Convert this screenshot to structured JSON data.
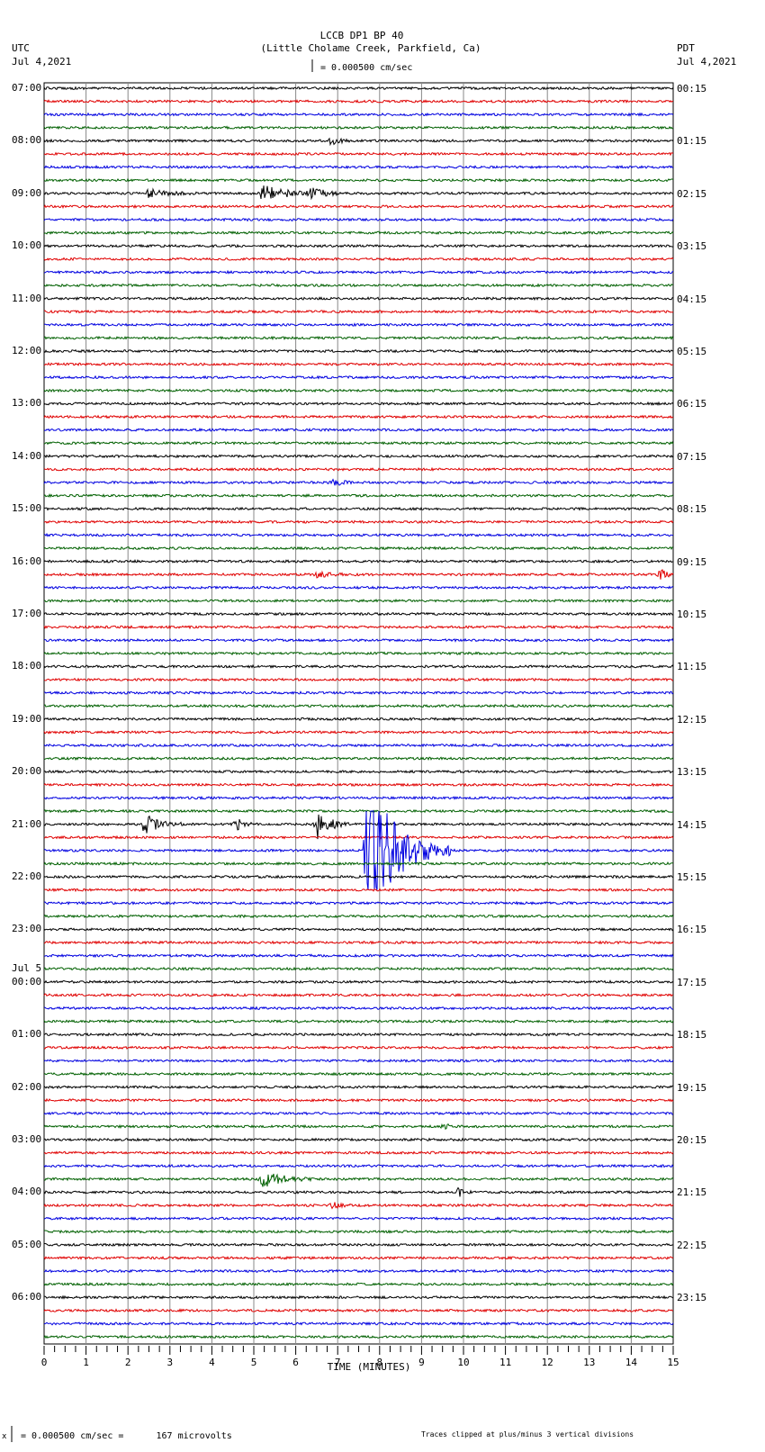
{
  "header": {
    "title": "LCCB DP1 BP 40",
    "subtitle": "(Little Cholame Creek, Parkfield, Ca)",
    "left_tz": "UTC",
    "left_date": "Jul 4,2021",
    "right_tz": "PDT",
    "right_date": "Jul 4,2021",
    "scale_label": "= 0.000500 cm/sec"
  },
  "footer": {
    "scale_note": "= 0.000500 cm/sec =      167 microvolts",
    "clip_note": "Traces clipped at plus/minus 3 vertical divisions",
    "scale_prefix": "x"
  },
  "chart_data": {
    "type": "line",
    "title": "LCCB DP1 BP 40",
    "xlabel": "TIME (MINUTES)",
    "xlim": [
      0,
      15
    ],
    "x_ticks": [
      "0",
      "1",
      "2",
      "3",
      "4",
      "5",
      "6",
      "7",
      "8",
      "9",
      "10",
      "11",
      "12",
      "13",
      "14",
      "15"
    ],
    "traces_per_hour": 4,
    "trace_colors": [
      "#000000",
      "#e00000",
      "#0000e0",
      "#006000"
    ],
    "clip_divisions": 3,
    "left_labels": [
      "07:00",
      "08:00",
      "09:00",
      "10:00",
      "11:00",
      "12:00",
      "13:00",
      "14:00",
      "15:00",
      "16:00",
      "17:00",
      "18:00",
      "19:00",
      "20:00",
      "21:00",
      "22:00",
      "23:00",
      "00:00",
      "01:00",
      "02:00",
      "03:00",
      "04:00",
      "05:00",
      "06:00"
    ],
    "left_date_change": {
      "index": 17,
      "label": "Jul 5"
    },
    "right_labels": [
      "00:15",
      "01:15",
      "02:15",
      "03:15",
      "04:15",
      "05:15",
      "06:15",
      "07:15",
      "08:15",
      "09:15",
      "10:15",
      "11:15",
      "12:15",
      "13:15",
      "14:15",
      "15:15",
      "16:15",
      "17:15",
      "18:15",
      "19:15",
      "20:15",
      "21:15",
      "22:15",
      "23:15"
    ],
    "events": [
      {
        "trace": 4,
        "minute": 6.8,
        "amp": 0.35,
        "dur": 0.6
      },
      {
        "trace": 8,
        "minute": 2.5,
        "amp": 0.3,
        "dur": 1.2
      },
      {
        "trace": 8,
        "minute": 5.2,
        "amp": 0.6,
        "dur": 1.8
      },
      {
        "trace": 8,
        "minute": 6.4,
        "amp": 0.45,
        "dur": 0.6
      },
      {
        "trace": 30,
        "minute": 6.9,
        "amp": 0.25,
        "dur": 0.6
      },
      {
        "trace": 37,
        "minute": 14.7,
        "amp": 0.4,
        "dur": 0.4
      },
      {
        "trace": 37,
        "minute": 6.5,
        "amp": 0.2,
        "dur": 1.0
      },
      {
        "trace": 56,
        "minute": 2.4,
        "amp": 0.8,
        "dur": 1.0
      },
      {
        "trace": 56,
        "minute": 4.6,
        "amp": 0.6,
        "dur": 0.4
      },
      {
        "trace": 56,
        "minute": 6.5,
        "amp": 1.2,
        "dur": 0.8
      },
      {
        "trace": 58,
        "minute": 7.7,
        "amp": 6.0,
        "dur": 2.0
      },
      {
        "trace": 79,
        "minute": 9.5,
        "amp": 0.25,
        "dur": 0.6
      },
      {
        "trace": 83,
        "minute": 5.2,
        "amp": 0.8,
        "dur": 1.2
      },
      {
        "trace": 84,
        "minute": 9.9,
        "amp": 0.35,
        "dur": 0.3
      },
      {
        "trace": 85,
        "minute": 6.9,
        "amp": 0.3,
        "dur": 0.4
      }
    ]
  }
}
